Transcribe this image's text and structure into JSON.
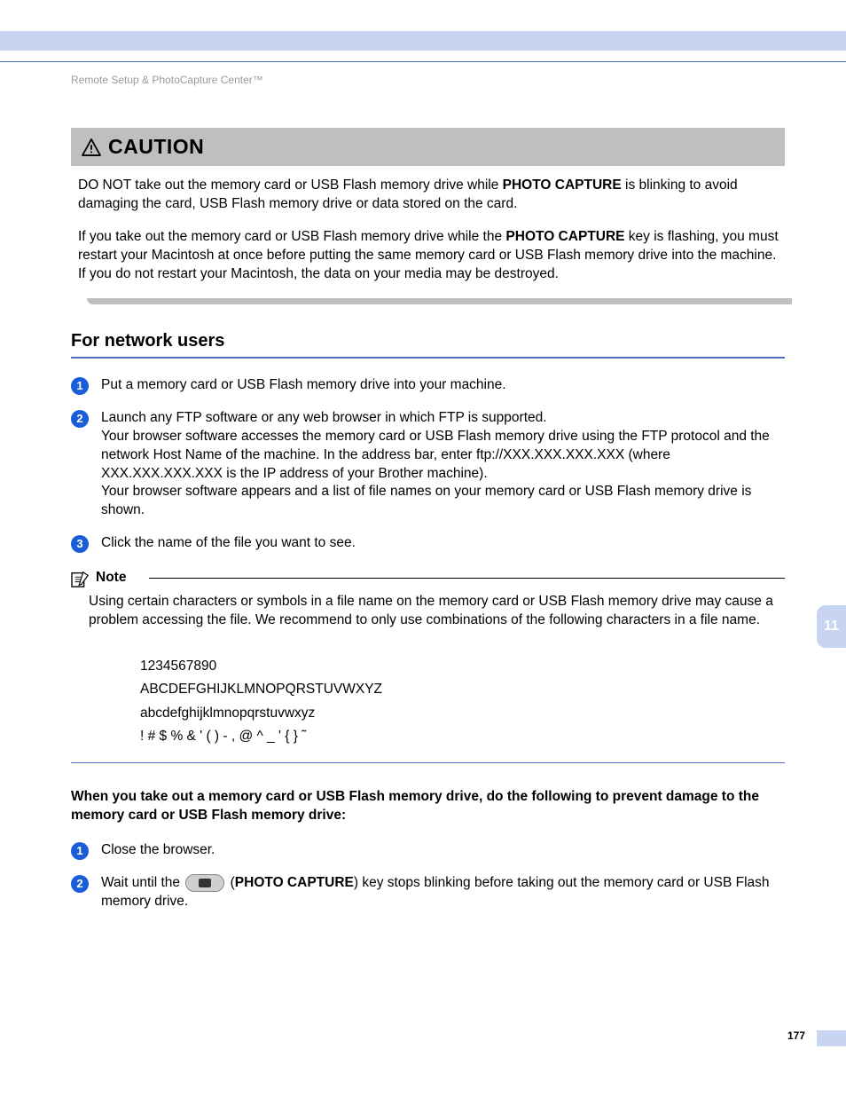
{
  "running_head": "Remote Setup & PhotoCapture Center™",
  "caution": {
    "title": "CAUTION",
    "p1_a": "DO NOT take out the memory card or USB Flash memory drive while ",
    "p1_b": "PHOTO CAPTURE",
    "p1_c": " is blinking to avoid damaging the card, USB Flash memory drive or data stored on the card.",
    "p2_a": "If you take out the memory card or USB Flash memory drive while the ",
    "p2_b": "PHOTO CAPTURE",
    "p2_c": " key is flashing, you must restart your Macintosh at once before putting the same memory card or USB Flash memory drive into the machine. If you do not restart your Macintosh, the data on your media may be destroyed."
  },
  "section_title": "For network users",
  "steps_a": {
    "s1": "Put a memory card or USB Flash memory drive into your machine.",
    "s2": "Launch any FTP software or any web browser in which FTP is supported.\nYour browser software accesses the memory card or USB Flash memory drive using the FTP protocol and the network Host Name of the machine. In the address bar, enter ftp://XXX.XXX.XXX.XXX (where XXX.XXX.XXX.XXX is the IP address of your Brother machine).\nYour browser software appears and a list of file names on your memory card or USB Flash memory drive is shown.",
    "s3": "Click the name of the file you want to see."
  },
  "note": {
    "label": "Note",
    "body": "Using certain characters or symbols in a file name on the memory card or USB Flash memory drive may cause a problem accessing the file. We recommend to only use combinations of the following characters in a file name.",
    "charset": {
      "l1": "1234567890",
      "l2": "ABCDEFGHIJKLMNOPQRSTUVWXYZ",
      "l3": "abcdefghijklmnopqrstuvwxyz",
      "l4": "! # $ % & ' ( ) - , @ ^ _ ' { } ˜"
    }
  },
  "imperative": "When you take out a memory card or USB Flash memory drive, do the following to prevent damage to the memory card or USB Flash memory drive:",
  "steps_b": {
    "s1": "Close the browser.",
    "s2_a": "Wait until the ",
    "s2_b": " (",
    "s2_c": "PHOTO CAPTURE",
    "s2_d": ") key stops blinking before taking out the memory card or USB Flash memory drive."
  },
  "chapter_tab": "11",
  "page_number": "177"
}
